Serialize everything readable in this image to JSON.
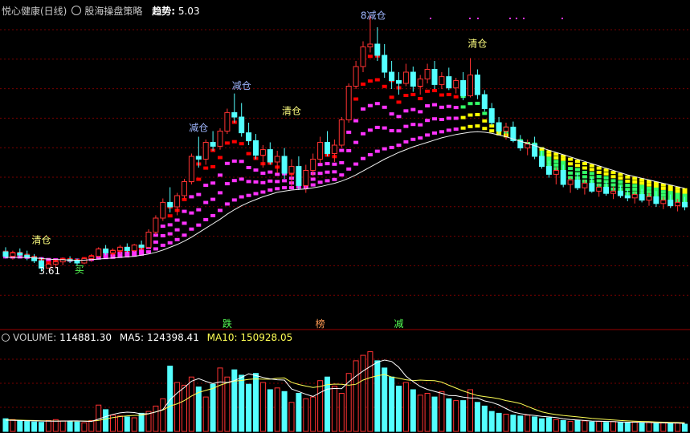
{
  "header": {
    "stock_name": "悦心健康(日线)",
    "indicator_name": "股海操盘策略",
    "trend_label": "趋势:",
    "trend_value": "5.03"
  },
  "volume_header": {
    "volume_label": "VOLUME:",
    "volume_value": "114881.30",
    "ma5_label": "MA5:",
    "ma5_value": "124398.41",
    "ma10_label": "MA10:",
    "ma10_value": "150928.05"
  },
  "colors": {
    "background": "#000000",
    "up_candle": "#ff3232",
    "down_candle": "#54ffff",
    "ribbon_magenta": "#ff33ff",
    "ribbon_red": "#ff0000",
    "ribbon_yellow": "#ffff00",
    "ribbon_green": "#33ff66",
    "ma_line": "#f0f0f0",
    "vol_ma5": "#ffffff",
    "vol_ma10": "#ffff55",
    "grid": "#7a0000",
    "label_yellow": "#ffff80",
    "label_blue": "#9fb7ff",
    "label_green": "#55ff55",
    "label_orange": "#ff9b55"
  },
  "chart_data": [
    {
      "type": "candlestick",
      "y_domain": [
        2.6,
        8.1
      ],
      "ohlc": [
        [
          3.9,
          3.98,
          3.78,
          3.82
        ],
        [
          3.82,
          3.92,
          3.76,
          3.88
        ],
        [
          3.88,
          3.96,
          3.8,
          3.84
        ],
        [
          3.84,
          3.92,
          3.75,
          3.8
        ],
        [
          3.8,
          3.86,
          3.7,
          3.74
        ],
        [
          3.74,
          3.8,
          3.55,
          3.61
        ],
        [
          3.61,
          3.7,
          3.61,
          3.68
        ],
        [
          3.68,
          3.76,
          3.62,
          3.72
        ],
        [
          3.72,
          3.8,
          3.66,
          3.76
        ],
        [
          3.76,
          3.82,
          3.7,
          3.74
        ],
        [
          3.74,
          3.78,
          3.66,
          3.7
        ],
        [
          3.7,
          3.8,
          3.68,
          3.78
        ],
        [
          3.78,
          3.86,
          3.72,
          3.82
        ],
        [
          3.82,
          3.98,
          3.8,
          3.95
        ],
        [
          3.95,
          4.02,
          3.84,
          3.88
        ],
        [
          3.88,
          3.96,
          3.82,
          3.92
        ],
        [
          3.92,
          4.02,
          3.86,
          3.98
        ],
        [
          3.98,
          4.05,
          3.88,
          3.92
        ],
        [
          3.92,
          4.04,
          3.9,
          4.02
        ],
        [
          4.02,
          4.1,
          3.94,
          3.98
        ],
        [
          3.98,
          4.3,
          3.96,
          4.25
        ],
        [
          4.25,
          4.55,
          4.2,
          4.5
        ],
        [
          4.5,
          4.85,
          4.45,
          4.78
        ],
        [
          4.78,
          5.05,
          4.6,
          4.7
        ],
        [
          4.7,
          4.95,
          4.55,
          4.9
        ],
        [
          4.9,
          5.2,
          4.85,
          5.15
        ],
        [
          5.15,
          5.65,
          5.1,
          5.6
        ],
        [
          5.6,
          5.95,
          5.4,
          5.55
        ],
        [
          5.55,
          5.9,
          5.45,
          5.85
        ],
        [
          5.85,
          6.05,
          5.7,
          5.78
        ],
        [
          5.78,
          6.1,
          5.72,
          6.05
        ],
        [
          6.05,
          6.45,
          6.0,
          6.38
        ],
        [
          6.38,
          6.72,
          6.2,
          6.3
        ],
        [
          6.3,
          6.55,
          5.95,
          6.02
        ],
        [
          6.02,
          6.2,
          5.8,
          5.88
        ],
        [
          5.88,
          6.0,
          5.55,
          5.62
        ],
        [
          5.62,
          5.8,
          5.4,
          5.72
        ],
        [
          5.72,
          5.85,
          5.45,
          5.5
        ],
        [
          5.5,
          5.7,
          5.3,
          5.6
        ],
        [
          5.6,
          5.75,
          5.2,
          5.3
        ],
        [
          5.3,
          5.55,
          5.05,
          5.42
        ],
        [
          5.42,
          5.6,
          5.0,
          5.08
        ],
        [
          5.08,
          5.45,
          4.95,
          5.35
        ],
        [
          5.35,
          5.65,
          5.25,
          5.55
        ],
        [
          5.55,
          5.95,
          5.48,
          5.85
        ],
        [
          5.85,
          6.05,
          5.6,
          5.65
        ],
        [
          5.65,
          5.9,
          5.5,
          5.8
        ],
        [
          5.8,
          6.3,
          5.75,
          6.25
        ],
        [
          6.25,
          6.9,
          6.2,
          6.85
        ],
        [
          6.85,
          7.3,
          6.8,
          7.2
        ],
        [
          7.2,
          7.65,
          7.1,
          7.55
        ],
        [
          7.55,
          8.1,
          7.45,
          7.6
        ],
        [
          7.6,
          7.9,
          7.3,
          7.4
        ],
        [
          7.4,
          7.6,
          7.0,
          7.1
        ],
        [
          7.1,
          7.3,
          6.8,
          6.95
        ],
        [
          6.95,
          7.1,
          6.7,
          6.9
        ],
        [
          6.9,
          7.25,
          6.85,
          7.1
        ],
        [
          7.1,
          7.2,
          6.75,
          6.85
        ],
        [
          6.85,
          7.05,
          6.7,
          6.98
        ],
        [
          6.98,
          7.25,
          6.9,
          7.15
        ],
        [
          7.15,
          7.3,
          6.8,
          6.88
        ],
        [
          6.88,
          7.1,
          6.8,
          7.02
        ],
        [
          7.02,
          7.18,
          6.78,
          6.82
        ],
        [
          6.82,
          7.0,
          6.72,
          6.95
        ],
        [
          6.95,
          7.1,
          6.6,
          6.68
        ],
        [
          6.68,
          7.35,
          6.65,
          7.05
        ],
        [
          7.05,
          7.15,
          6.62,
          6.7
        ],
        [
          6.7,
          6.78,
          6.4,
          6.45
        ],
        [
          6.45,
          6.55,
          6.15,
          6.2
        ],
        [
          6.2,
          6.3,
          6.0,
          6.05
        ],
        [
          6.05,
          6.2,
          5.9,
          6.12
        ],
        [
          6.12,
          6.22,
          5.85,
          5.88
        ],
        [
          5.88,
          5.98,
          5.7,
          5.75
        ],
        [
          5.75,
          5.9,
          5.62,
          5.82
        ],
        [
          5.82,
          5.95,
          5.55,
          5.6
        ],
        [
          5.6,
          5.7,
          5.38,
          5.42
        ],
        [
          5.42,
          5.52,
          5.22,
          5.28
        ],
        [
          5.28,
          5.4,
          5.1,
          5.35
        ],
        [
          5.35,
          5.45,
          5.05,
          5.1
        ],
        [
          5.1,
          5.22,
          4.95,
          5.18
        ],
        [
          5.18,
          5.3,
          5.0,
          5.04
        ],
        [
          5.04,
          5.18,
          4.92,
          5.12
        ],
        [
          5.12,
          5.22,
          4.95,
          4.98
        ],
        [
          4.98,
          5.1,
          4.88,
          5.05
        ],
        [
          5.05,
          5.15,
          4.9,
          4.94
        ],
        [
          4.94,
          5.06,
          4.84,
          4.98
        ],
        [
          4.98,
          5.08,
          4.86,
          4.9
        ],
        [
          4.9,
          5.0,
          4.8,
          4.86
        ],
        [
          4.86,
          4.96,
          4.76,
          4.92
        ],
        [
          4.92,
          5.02,
          4.78,
          4.82
        ],
        [
          4.82,
          4.95,
          4.72,
          4.88
        ],
        [
          4.88,
          4.98,
          4.7,
          4.76
        ],
        [
          4.76,
          4.88,
          4.66,
          4.82
        ],
        [
          4.82,
          4.92,
          4.68,
          4.72
        ],
        [
          4.72,
          4.84,
          4.62,
          4.78
        ],
        [
          4.78,
          4.88,
          4.64,
          4.7
        ]
      ],
      "ma_line": [
        3.8,
        3.8,
        3.8,
        3.8,
        3.79,
        3.78,
        3.77,
        3.76,
        3.76,
        3.75,
        3.75,
        3.75,
        3.76,
        3.77,
        3.78,
        3.79,
        3.8,
        3.81,
        3.82,
        3.84,
        3.86,
        3.89,
        3.93,
        3.98,
        4.03,
        4.09,
        4.16,
        4.24,
        4.32,
        4.4,
        4.48,
        4.57,
        4.65,
        4.72,
        4.78,
        4.83,
        4.88,
        4.92,
        4.96,
        4.98,
        5.0,
        5.01,
        5.02,
        5.04,
        5.06,
        5.09,
        5.12,
        5.16,
        5.21,
        5.27,
        5.34,
        5.41,
        5.48,
        5.55,
        5.61,
        5.67,
        5.72,
        5.77,
        5.81,
        5.85,
        5.89,
        5.93,
        5.96,
        5.99,
        6.01,
        6.03,
        6.04,
        6.03,
        6.01,
        5.98,
        5.95,
        5.91,
        5.87,
        5.83,
        5.79,
        5.75,
        5.71,
        5.67,
        5.63,
        5.59,
        5.55,
        5.51,
        5.47,
        5.43,
        5.39,
        5.35,
        5.31,
        5.27,
        5.24,
        5.21,
        5.18,
        5.15,
        5.12,
        5.09,
        5.06,
        5.03
      ],
      "annotations": [
        {
          "text": "清仓",
          "bar": 5,
          "price": 4.05,
          "color": "label_yellow"
        },
        {
          "text": "3.61",
          "bar": 6,
          "price": 3.5,
          "color": "white"
        },
        {
          "text": "买",
          "bar": 11,
          "price": 3.52,
          "color": "label_green"
        },
        {
          "text": "减仓",
          "bar": 27,
          "price": 6.05,
          "color": "label_blue"
        },
        {
          "text": "减仓",
          "bar": 33,
          "price": 6.8,
          "color": "label_blue"
        },
        {
          "text": "清仓",
          "bar": 40,
          "price": 6.35,
          "color": "label_yellow"
        },
        {
          "text": "8减仓",
          "bar": 51,
          "price": 8.05,
          "color": "label_blue"
        },
        {
          "text": "清仓",
          "bar": 66,
          "price": 7.55,
          "color": "label_yellow"
        }
      ],
      "signals": [
        {
          "text": "跌",
          "bar": 31,
          "color": "label_green"
        },
        {
          "text": "榜",
          "bar": 44,
          "color": "label_orange"
        },
        {
          "text": "减",
          "bar": 55,
          "color": "label_green"
        }
      ]
    },
    {
      "type": "volume_bar",
      "y_domain": [
        0,
        500000
      ],
      "values": [
        70000,
        65000,
        60000,
        55000,
        52000,
        50000,
        60000,
        65000,
        58000,
        55000,
        52000,
        48000,
        60000,
        145000,
        120000,
        90000,
        85000,
        80000,
        75000,
        100000,
        110000,
        140000,
        180000,
        360000,
        270000,
        255000,
        300000,
        245000,
        190000,
        260000,
        350000,
        300000,
        340000,
        310000,
        260000,
        320000,
        270000,
        230000,
        240000,
        220000,
        160000,
        210000,
        180000,
        190000,
        280000,
        300000,
        250000,
        210000,
        320000,
        390000,
        420000,
        440000,
        390000,
        350000,
        300000,
        250000,
        270000,
        230000,
        200000,
        210000,
        190000,
        220000,
        180000,
        170000,
        170000,
        230000,
        160000,
        140000,
        110000,
        100000,
        95000,
        90000,
        85000,
        90000,
        80000,
        70000,
        75000,
        65000,
        60000,
        55000,
        60000,
        58000,
        52000,
        55000,
        50000,
        54000,
        50000,
        48000,
        52000,
        46000,
        50000,
        44000,
        48000,
        42000,
        46000,
        40000
      ],
      "ma5": [
        62000,
        61000,
        60000,
        59000,
        58000,
        57000,
        56000,
        56000,
        57000,
        58000,
        58000,
        56000,
        55000,
        68000,
        82000,
        94000,
        102000,
        106000,
        104000,
        96000,
        98000,
        107000,
        121000,
        175000,
        212000,
        242000,
        277000,
        291000,
        276000,
        264000,
        273000,
        270000,
        280000,
        298000,
        318000,
        308000,
        298000,
        290000,
        285000,
        283000,
        234000,
        220000,
        205000,
        193000,
        214000,
        233000,
        237000,
        236000,
        274000,
        305000,
        333000,
        358000,
        382000,
        394000,
        386000,
        354000,
        305000,
        275000,
        248000,
        232000,
        221000,
        210000,
        198000,
        197000,
        189000,
        184000,
        184000,
        168000,
        160000,
        146000,
        126000,
        107000,
        98000,
        92000,
        88000,
        83000,
        80000,
        76000,
        70000,
        65000,
        63000,
        60000,
        57000,
        56000,
        55000,
        54000,
        52000,
        51000,
        51000,
        50000,
        49000,
        48000,
        47000,
        46000,
        46000,
        44000
      ],
      "ma10": [
        64000,
        63000,
        62000,
        61000,
        60000,
        59000,
        58000,
        57000,
        57000,
        57000,
        57000,
        57000,
        56000,
        61000,
        68000,
        76000,
        82000,
        86000,
        88000,
        90000,
        97000,
        108000,
        118000,
        140000,
        152000,
        170000,
        195000,
        215000,
        226000,
        237000,
        255000,
        268000,
        278000,
        281000,
        287000,
        290000,
        288000,
        288000,
        294000,
        295000,
        271000,
        259000,
        250000,
        242000,
        248000,
        258000,
        261000,
        260000,
        255000,
        260000,
        283000,
        297000,
        307000,
        314000,
        300000,
        294000,
        285000,
        280000,
        283000,
        281000,
        280000,
        272000,
        255000,
        239000,
        223000,
        210000,
        198000,
        192000,
        187000,
        180000,
        170000,
        163000,
        154000,
        138000,
        122000,
        108000,
        99000,
        93000,
        88000,
        84000,
        80000,
        76000,
        72000,
        69000,
        66000,
        63000,
        60000,
        58000,
        56000,
        55000,
        54000,
        52000,
        51000,
        50000,
        49000,
        48000
      ]
    }
  ]
}
